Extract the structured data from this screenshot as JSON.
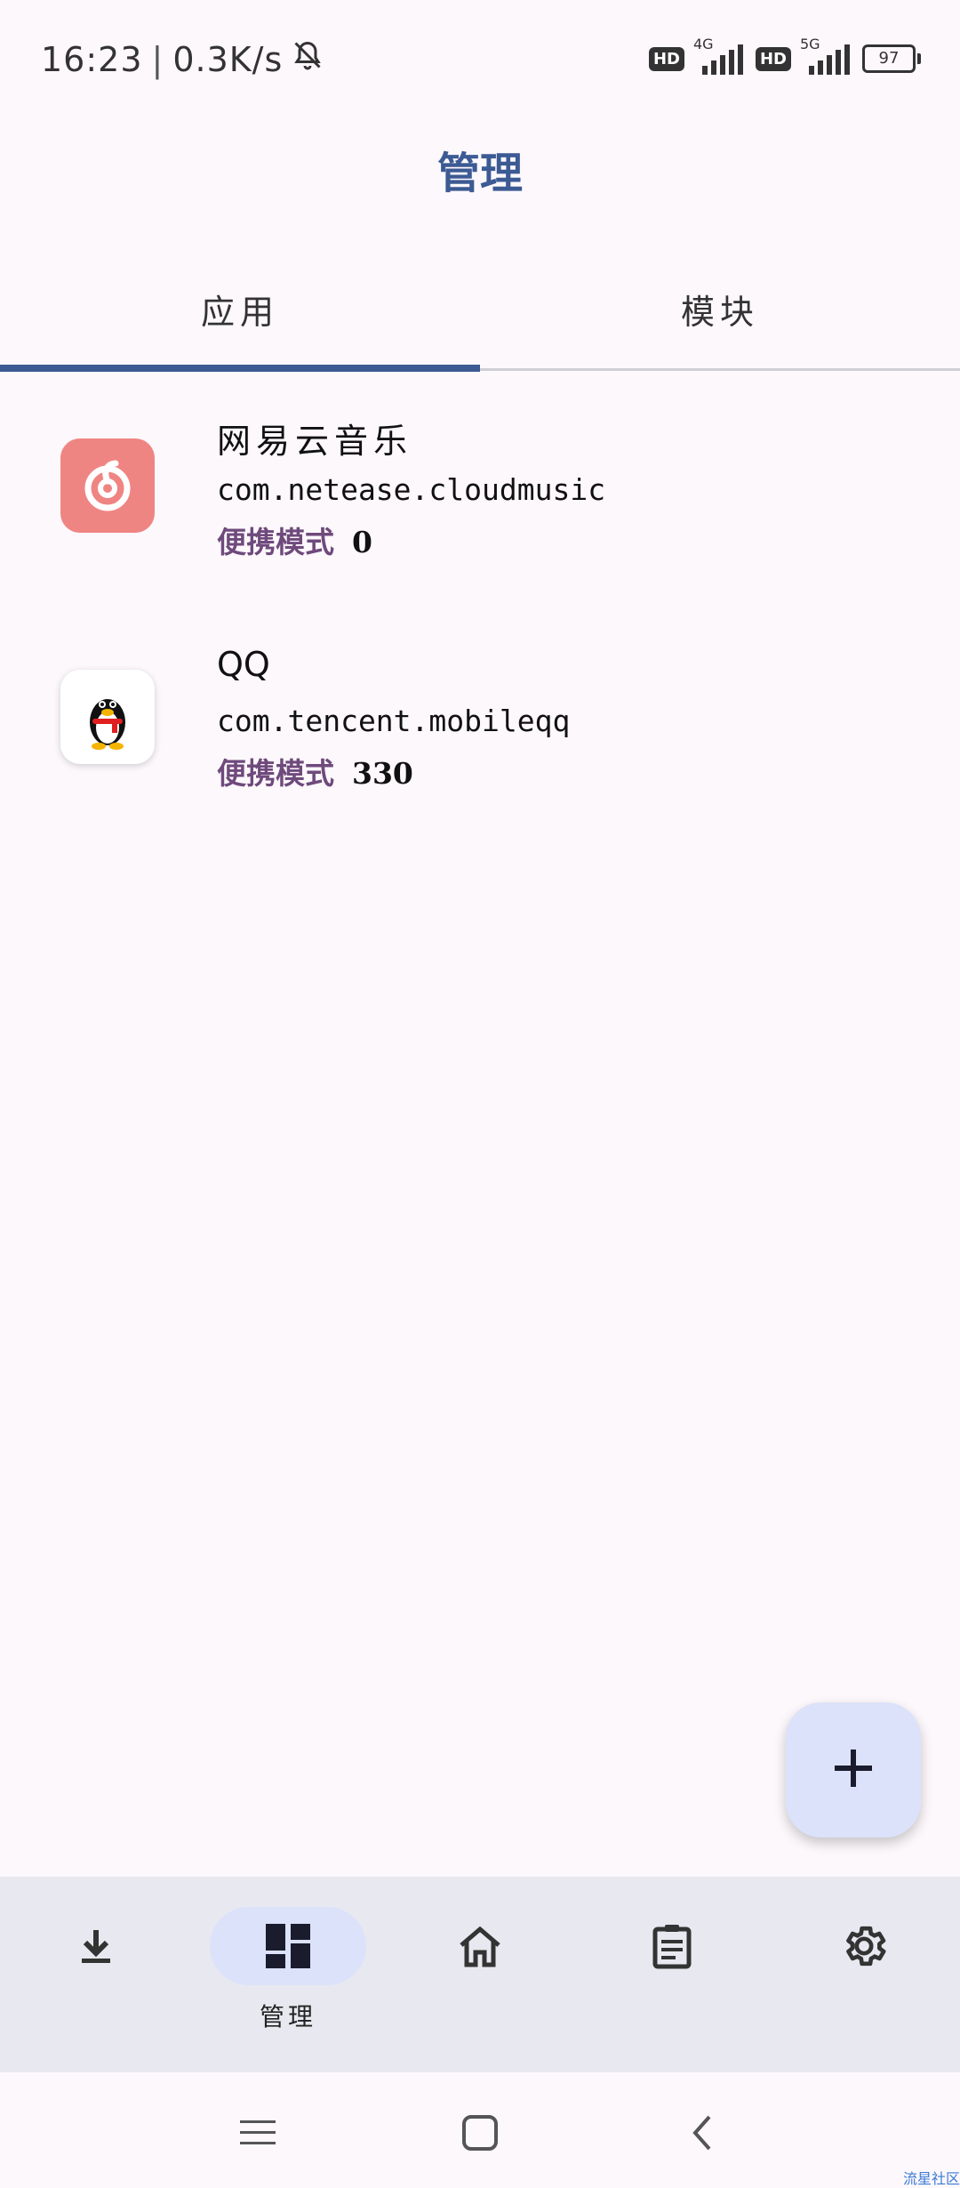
{
  "status_bar": {
    "time": "16:23",
    "speed": "0.3K/s",
    "hd1": "HD",
    "net1": "4G",
    "hd2": "HD",
    "net2": "5G",
    "battery": "97"
  },
  "page_title": "管理",
  "tabs": [
    {
      "label": "应用",
      "selected": true
    },
    {
      "label": "模块",
      "selected": false
    }
  ],
  "apps": [
    {
      "name": "网易云音乐",
      "package": "com.netease.cloudmusic",
      "mode_label": "便携模式",
      "count": "0",
      "icon": "netease-cloudmusic-icon"
    },
    {
      "name": "QQ",
      "package": "com.tencent.mobileqq",
      "mode_label": "便携模式",
      "count": "330",
      "icon": "qq-penguin-icon"
    }
  ],
  "fab": {
    "icon": "plus-icon"
  },
  "bottom_nav": [
    {
      "icon": "download-icon",
      "label": ""
    },
    {
      "icon": "dashboard-icon",
      "label": "管理",
      "selected": true
    },
    {
      "icon": "home-icon",
      "label": ""
    },
    {
      "icon": "clipboard-icon",
      "label": ""
    },
    {
      "icon": "gear-icon",
      "label": ""
    }
  ],
  "watermark": "流星社区",
  "colors": {
    "accent": "#3c5a93",
    "mode_label": "#6f4a7c",
    "netease": "#ef8583",
    "fab": "#dbe2f9",
    "nav_bg": "#e8e8f0"
  }
}
